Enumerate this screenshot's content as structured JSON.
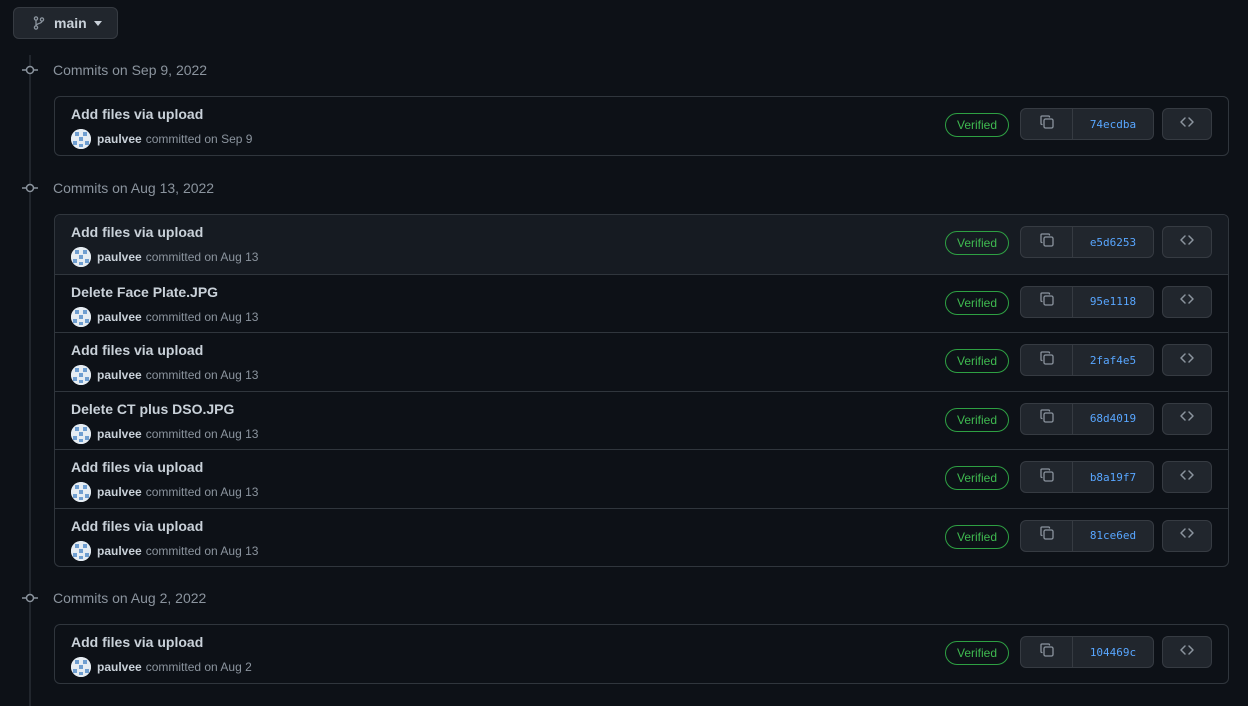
{
  "branch": {
    "name": "main",
    "icon": "git-branch-icon"
  },
  "colors": {
    "background": "#0d1117",
    "verified": "#3fb950",
    "sha": "#58a6ff",
    "border": "#30363d"
  },
  "groups": [
    {
      "label": "Commits on Sep 9, 2022",
      "commits": [
        {
          "title": "Add files via upload",
          "author": "paulvee",
          "meta": "committed on Sep 9",
          "verified": "Verified",
          "sha": "74ecdba"
        }
      ]
    },
    {
      "label": "Commits on Aug 13, 2022",
      "commits": [
        {
          "title": "Add files via upload",
          "author": "paulvee",
          "meta": "committed on Aug 13",
          "verified": "Verified",
          "sha": "e5d6253"
        },
        {
          "title": "Delete Face Plate.JPG",
          "author": "paulvee",
          "meta": "committed on Aug 13",
          "verified": "Verified",
          "sha": "95e1118"
        },
        {
          "title": "Add files via upload",
          "author": "paulvee",
          "meta": "committed on Aug 13",
          "verified": "Verified",
          "sha": "2faf4e5"
        },
        {
          "title": "Delete CT plus DSO.JPG",
          "author": "paulvee",
          "meta": "committed on Aug 13",
          "verified": "Verified",
          "sha": "68d4019"
        },
        {
          "title": "Add files via upload",
          "author": "paulvee",
          "meta": "committed on Aug 13",
          "verified": "Verified",
          "sha": "b8a19f7"
        },
        {
          "title": "Add files via upload",
          "author": "paulvee",
          "meta": "committed on Aug 13",
          "verified": "Verified",
          "sha": "81ce6ed"
        }
      ]
    },
    {
      "label": "Commits on Aug 2, 2022",
      "commits": [
        {
          "title": "Add files via upload",
          "author": "paulvee",
          "meta": "committed on Aug 2",
          "verified": "Verified",
          "sha": "104469c"
        }
      ]
    }
  ]
}
